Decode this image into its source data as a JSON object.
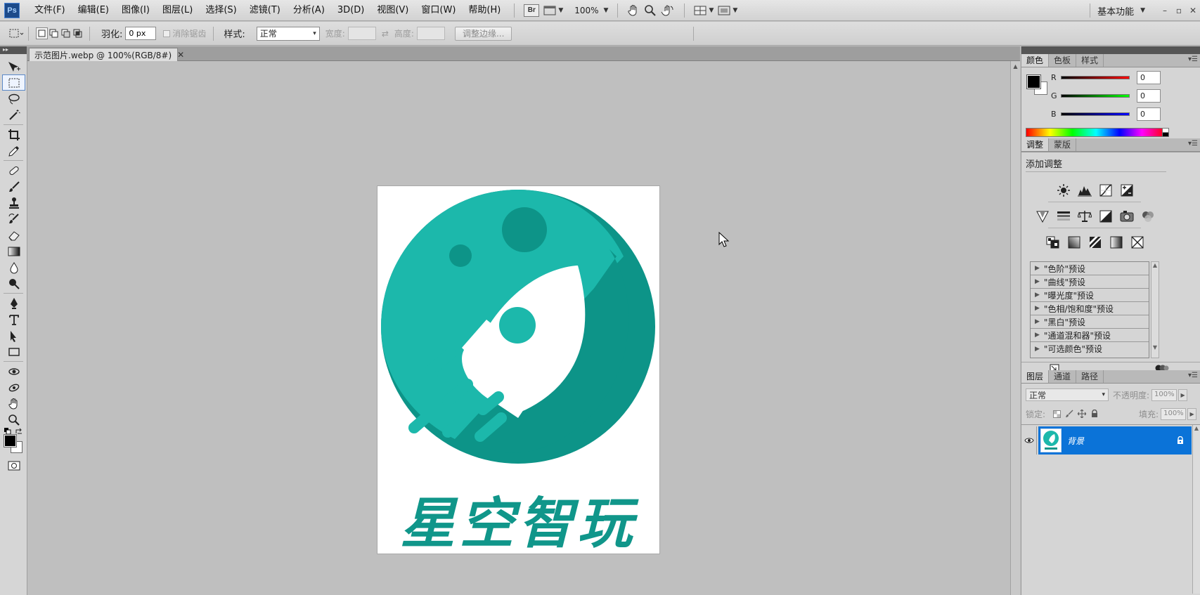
{
  "app": {
    "logo": "Ps",
    "workspace": "基本功能",
    "window_controls": [
      "–",
      "▫",
      "✕"
    ]
  },
  "menubar": {
    "items": [
      "文件(F)",
      "编辑(E)",
      "图像(I)",
      "图层(L)",
      "选择(S)",
      "滤镜(T)",
      "分析(A)",
      "3D(D)",
      "视图(V)",
      "窗口(W)",
      "帮助(H)"
    ],
    "bridge_label": "Br",
    "zoom": "100%"
  },
  "options": {
    "feather_label": "羽化:",
    "feather_value": "0 px",
    "antialias_label": "消除锯齿",
    "style_label": "样式:",
    "style_value": "正常",
    "width_label": "宽度:",
    "height_label": "高度:",
    "refine_edge": "调整边缘..."
  },
  "document": {
    "tab_title": "示范图片.webp @ 100%(RGB/8#)",
    "close": "✕",
    "logo_text": "星空智玩"
  },
  "panels": {
    "color_tabs": [
      "颜色",
      "色板",
      "样式"
    ],
    "color": {
      "r_label": "R",
      "r_value": "0",
      "g_label": "G",
      "g_value": "0",
      "b_label": "B",
      "b_value": "0",
      "foreground": "#000000",
      "background": "#ffffff"
    },
    "adjust_tabs": [
      "调整",
      "蒙版"
    ],
    "adjust_title": "添加调整",
    "presets": [
      "\"色阶\"预设",
      "\"曲线\"预设",
      "\"曝光度\"预设",
      "\"色相/饱和度\"预设",
      "\"黑白\"预设",
      "\"通道混和器\"预设",
      "\"可选颜色\"预设"
    ],
    "layers_tabs": [
      "图层",
      "通道",
      "路径"
    ],
    "layers": {
      "blend_mode": "正常",
      "opacity_label": "不透明度:",
      "opacity_value": "100%",
      "lock_label": "锁定:",
      "fill_label": "填充:",
      "fill_value": "100%",
      "items": [
        {
          "name": "背景"
        }
      ]
    }
  },
  "colors": {
    "logo_teal": "#1cb8ab",
    "logo_dark_teal": "#0d9488",
    "selection_blue": "#0b73d8"
  }
}
